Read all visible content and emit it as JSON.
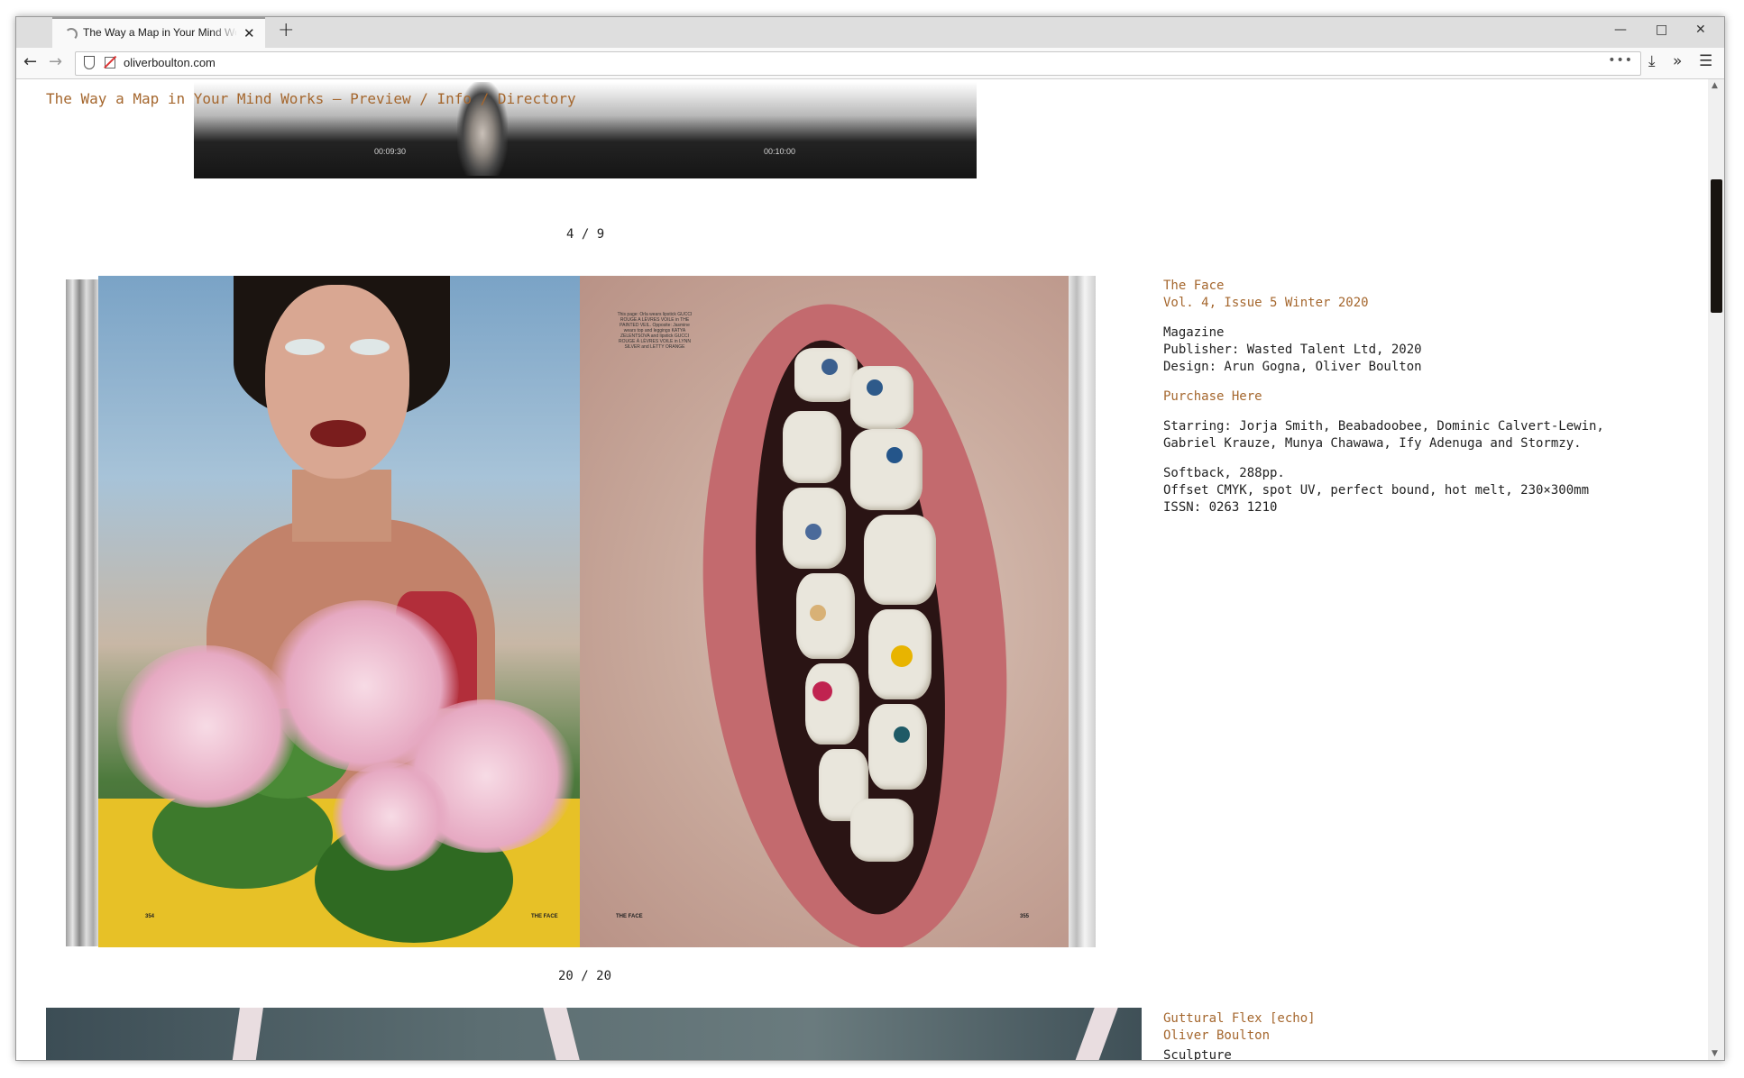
{
  "browser": {
    "tab_title": "The Way a Map in Your Mind Works",
    "url": "oliverboulton.com",
    "new_tab": "+",
    "close": "✕",
    "more": "•••"
  },
  "page": {
    "breadcrumb": "The Way a Map in Your Mind Works — Preview / Info / Directory",
    "video_timestamps": [
      "00:09:30",
      "00:10:00"
    ],
    "counter_top": "4 / 9",
    "counter_bottom": "20 / 20"
  },
  "spread": {
    "left_page_number": "354",
    "left_footer": "THE FACE",
    "right_footer": "THE FACE",
    "right_page_number": "355",
    "caption": "This page: Orla wears lipstick GUCCI ROUGE A LÈVRES VOILE in THE PAINTED VEIL. Opposite: Jasmine wears top and leggings KATYA ZELENTSOVA and lipstick GUCCI ROUGE À LÈVRES VOILE in LYNN SILVER and LETTY ORANGE"
  },
  "info": {
    "title": "The Face",
    "issue": "Vol. 4, Issue 5 Winter 2020",
    "type": "Magazine",
    "publisher": "Publisher: Wasted Talent Ltd, 2020",
    "design": "Design: Arun Gogna, Oliver Boulton",
    "purchase": "Purchase Here",
    "starring_1": "Starring: Jorja Smith, Beabadoobee, Dominic Calvert-Lewin,",
    "starring_2": "Gabriel Krauze, Munya Chawawa, Ify Adenuga and Stormzy.",
    "format": "Softback, 288pp.",
    "print": "Offset CMYK, spot UV, perfect bound, hot melt, 230×300mm",
    "issn": "ISSN: 0263 1210"
  },
  "next": {
    "title": "Guttural Flex [echo]",
    "author": "Oliver Boulton",
    "type": "Sculpture"
  },
  "colors": {
    "accent": "#a5672e",
    "text": "#222222"
  }
}
